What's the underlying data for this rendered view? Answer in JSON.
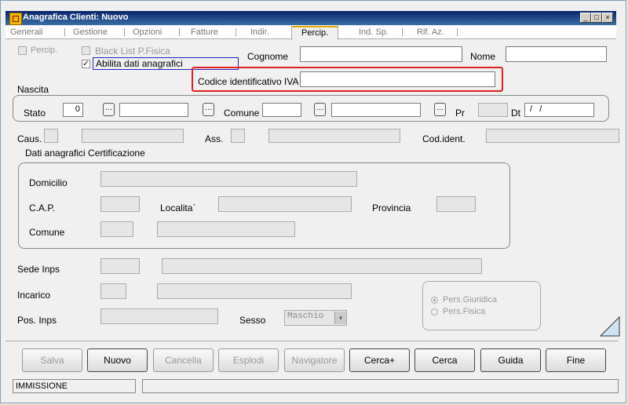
{
  "window": {
    "title": "Anagrafica Clienti: Nuovo",
    "minimize": "_",
    "maximize": "□",
    "close": "×"
  },
  "tabs": [
    "Generali",
    "Gestione",
    "Opzioni",
    "Fatture",
    "Indir.",
    "Percip.",
    "Ind. Sp.",
    "Rif. Az."
  ],
  "tab_separator": "|",
  "active_tab": "Percip.",
  "checks": {
    "percip": "Percip.",
    "blacklist": "Black List P.Fisica",
    "abilita": "Abilita dati anagrafici",
    "abilita_checked": "✓"
  },
  "labels": {
    "cognome": "Cognome",
    "nome": "Nome",
    "codice_iva": "Codice identificativo IVA",
    "nascita": "Nascita",
    "stato": "Stato",
    "comune": "Comune",
    "pr": "Pr",
    "dt": "Dt",
    "caus": "Caus.",
    "ass": "Ass.",
    "cod_ident": "Cod.ident.",
    "cert_title": "Dati anagrafici Certificazione",
    "domicilio": "Domicilio",
    "cap": "C.A.P.",
    "localita": "Localita`",
    "provincia": "Provincia",
    "comune2": "Comune",
    "sede_inps": "Sede Inps",
    "incarico": "Incarico",
    "pos_inps": "Pos. Inps",
    "sesso": "Sesso"
  },
  "values": {
    "stato_code": "0",
    "dt": " /   / ",
    "sesso": "Maschio",
    "dots": "…",
    "dropdown": "▾"
  },
  "radios": {
    "giuridica": "Pers.Giuridica",
    "fisica": "Pers.Fisica"
  },
  "buttons": {
    "salva": "Salva",
    "nuovo": "Nuovo",
    "cancella": "Cancella",
    "esplodi": "Esplodi",
    "navigatore": "Navigatore",
    "cerca_plus": "Cerca+",
    "cerca": "Cerca",
    "guida": "Guida",
    "fine": "Fine"
  },
  "status": {
    "mode": "IMMISSIONE",
    "message": ""
  },
  "colors": {
    "highlight": "#e02020",
    "title_bar": "#0a246a",
    "focus_box": "#2020c0"
  }
}
